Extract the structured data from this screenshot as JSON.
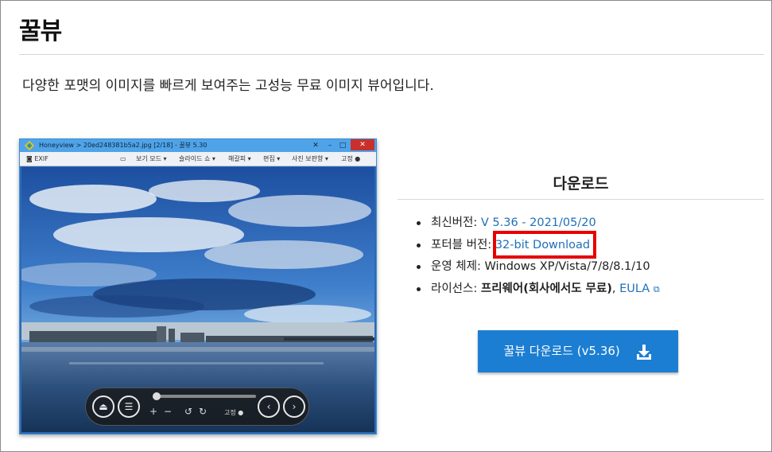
{
  "page": {
    "title": "꿀뷰",
    "description": "다양한 포맷의 이미지를 빠르게 보여주는 고성능 무료 이미지 뷰어입니다."
  },
  "screenshot": {
    "window_title": "Honeyview > 20ed248381b5a2.jpg [2/18] - 꿀뷰 5.30",
    "exif_label": "EXIF",
    "toolbar": [
      "보기 모드",
      "슬라이드 쇼",
      "해갈피",
      "편집",
      "사진 보판향"
    ],
    "pin_label": "고정",
    "nav_pin_label": "고정",
    "icons": [
      "honeyview-logo-icon",
      "camera-icon",
      "pin-icon",
      "eject-icon",
      "menu-icon",
      "plus-icon",
      "minus-icon",
      "rotate-left-icon",
      "rotate-right-icon",
      "prev-icon",
      "next-icon"
    ]
  },
  "download": {
    "heading": "다운로드",
    "latest_label": "최신버전: ",
    "latest_value": "V 5.36 - 2021/05/20",
    "portable_label": "포터블 버전: ",
    "portable_value": "32-bit Download",
    "os_label": "운영 체제: ",
    "os_value": "Windows XP/Vista/7/8/8.1/10",
    "license_label": "라이선스: ",
    "license_value": "프리웨어(회사에서도 무료)",
    "license_sep": ", ",
    "eula": "EULA",
    "button_label": "꿀뷰 다운로드 (v5.36)",
    "button_icon": "download-icon"
  },
  "colors": {
    "link": "#1f6fb8",
    "button": "#1c7ed2",
    "highlight": "#e60000"
  }
}
